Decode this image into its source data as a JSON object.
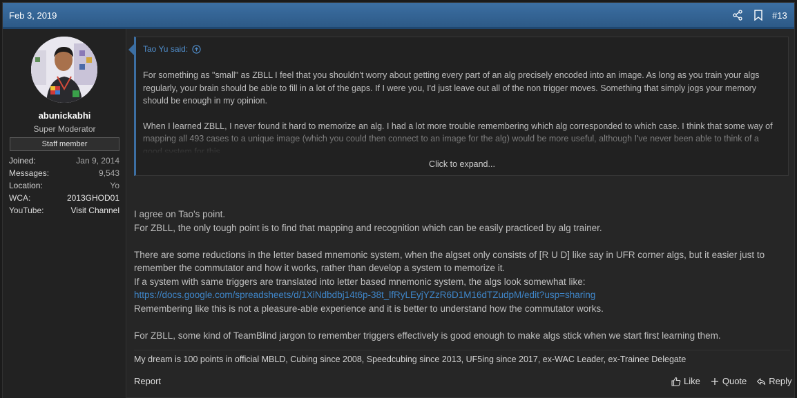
{
  "header": {
    "date": "Feb 3, 2019",
    "post_number": "#13"
  },
  "user": {
    "name": "abunickabhi",
    "title": "Super Moderator",
    "badge": "Staff member",
    "stats": [
      {
        "key": "Joined:",
        "value": "Jan 9, 2014"
      },
      {
        "key": "Messages:",
        "value": "9,543"
      },
      {
        "key": "Location:",
        "value": "Yo"
      },
      {
        "key": "WCA:",
        "value": "2013GHOD01"
      },
      {
        "key": "YouTube:",
        "value": "Visit Channel"
      }
    ]
  },
  "quote": {
    "author": "Tao Yu said:",
    "paragraphs": [
      "For something as \"small\" as ZBLL I feel that you shouldn't worry about getting every part of an alg precisely encoded into an image. As long as you train your algs regularly, your brain should be able to fill in a lot of the gaps. If I were you, I'd just leave out all of the non trigger moves. Something that simply jogs your memory should be enough in my opinion.",
      "When I learned ZBLL, I never found it hard to memorize an alg. I had a lot more trouble remembering which alg corresponded to which case. I think that some way of mapping all 493 cases to a unique image (which you could then connect to an image for the alg) would be more useful, although I've never been able to think of a good system for this."
    ],
    "expand_label": "Click to expand..."
  },
  "body": {
    "l1": "I agree on Tao's point.",
    "l2": "For ZBLL, the only tough point is to find that mapping and recognition which can be easily practiced by alg trainer.",
    "l3": "There are some reductions in the letter based mnemonic system, when the algset only consists of [R U D] like say in UFR corner algs, but it easier just to",
    "l4": "remember the commutator and how it works, rather than develop a system to memorize it.",
    "l5": "If a system with same triggers are translated into letter based mnemonic system, the algs look somewhat like:",
    "link": "https://docs.google.com/spreadsheets/d/1XiNdbdbj14t6p-38t_lfRyLEyjYZzR6D1M16dTZudpM/edit?usp=sharing",
    "l6": "Remembering like this is not a pleasure-able experience and it is better to understand how the commutator works.",
    "l7": "For ZBLL, some kind of TeamBlind jargon to remember triggers effectively is good enough to make algs stick when we start first learning them."
  },
  "signature": "My dream is 100 points in official MBLD, Cubing since 2008, Speedcubing since 2013, UF5ing since 2017, ex-WAC Leader, ex-Trainee Delegate",
  "footer": {
    "report": "Report",
    "like": "Like",
    "quote": "Quote",
    "reply": "Reply"
  },
  "icons": {
    "share": "share-icon",
    "bookmark": "bookmark-icon",
    "like": "thumbs-up-icon",
    "quote": "plus-icon",
    "reply": "reply-arrow-icon",
    "goto": "arrow-up-circle-icon"
  },
  "colors": {
    "header": "#3c6fa3",
    "link": "#3f86c9",
    "background": "#262626"
  }
}
